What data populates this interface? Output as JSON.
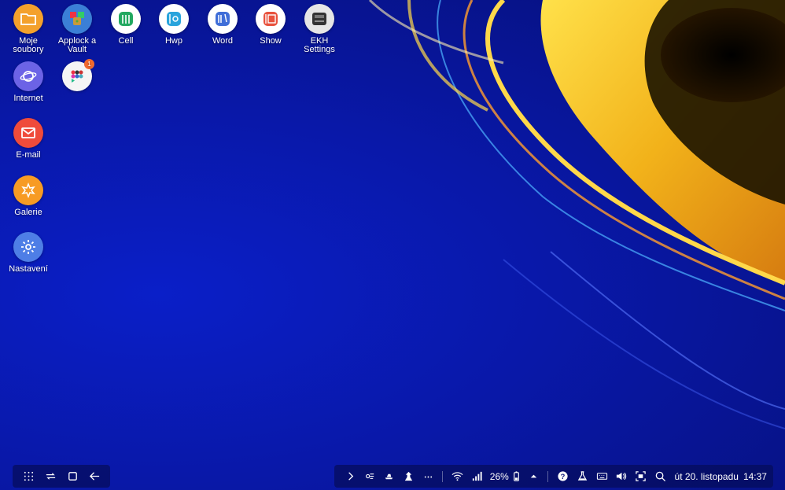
{
  "desktop_icons": [
    {
      "label": "Moje soubory",
      "icon": "folder-icon",
      "color": "#f4a12c"
    },
    {
      "label": "Applock a Vault",
      "icon": "lock-icon",
      "color": "#3b7fd6"
    },
    {
      "label": "Cell",
      "icon": "spreadsheet-icon",
      "color": "#ffffff"
    },
    {
      "label": "Hwp",
      "icon": "hwp-doc-icon",
      "color": "#ffffff"
    },
    {
      "label": "Word",
      "icon": "word-doc-icon",
      "color": "#ffffff"
    },
    {
      "label": "Show",
      "icon": "presentation-icon",
      "color": "#ffffff"
    },
    {
      "label": "EKH Settings",
      "icon": "keyboard-settings-icon",
      "color": "#e6e6e6"
    },
    {
      "label": "Internet",
      "icon": "internet-planet-icon",
      "color": "#6c63e6"
    },
    {
      "label": "",
      "icon": "app-folder-icon",
      "color": "#f5f5f5",
      "badge": "1"
    },
    {
      "label": "E-mail",
      "icon": "email-icon",
      "color": "#ef4b3b"
    },
    {
      "label": "Galerie",
      "icon": "gallery-flower-icon",
      "color": "#f79b24"
    },
    {
      "label": "Nastavení",
      "icon": "settings-gear-icon",
      "color": "#4e7ee6"
    }
  ],
  "taskbar": {
    "battery_percent": "26%",
    "date": "út 20. listopadu",
    "time": "14:37",
    "left_buttons": [
      "apps-grid-icon",
      "recent-apps-icon",
      "home-square-icon",
      "back-arrow-icon"
    ],
    "right_icons": [
      "expand-chevron-icon",
      "notification-app-icon-1",
      "notification-app-icon-2",
      "notification-app-icon-3",
      "more-dots-icon",
      "wifi-icon",
      "signal-icon",
      "battery-icon",
      "caret-up-icon",
      "help-icon",
      "lab-flask-icon",
      "keyboard-icon",
      "volume-icon",
      "screenshot-icon",
      "search-icon"
    ]
  }
}
